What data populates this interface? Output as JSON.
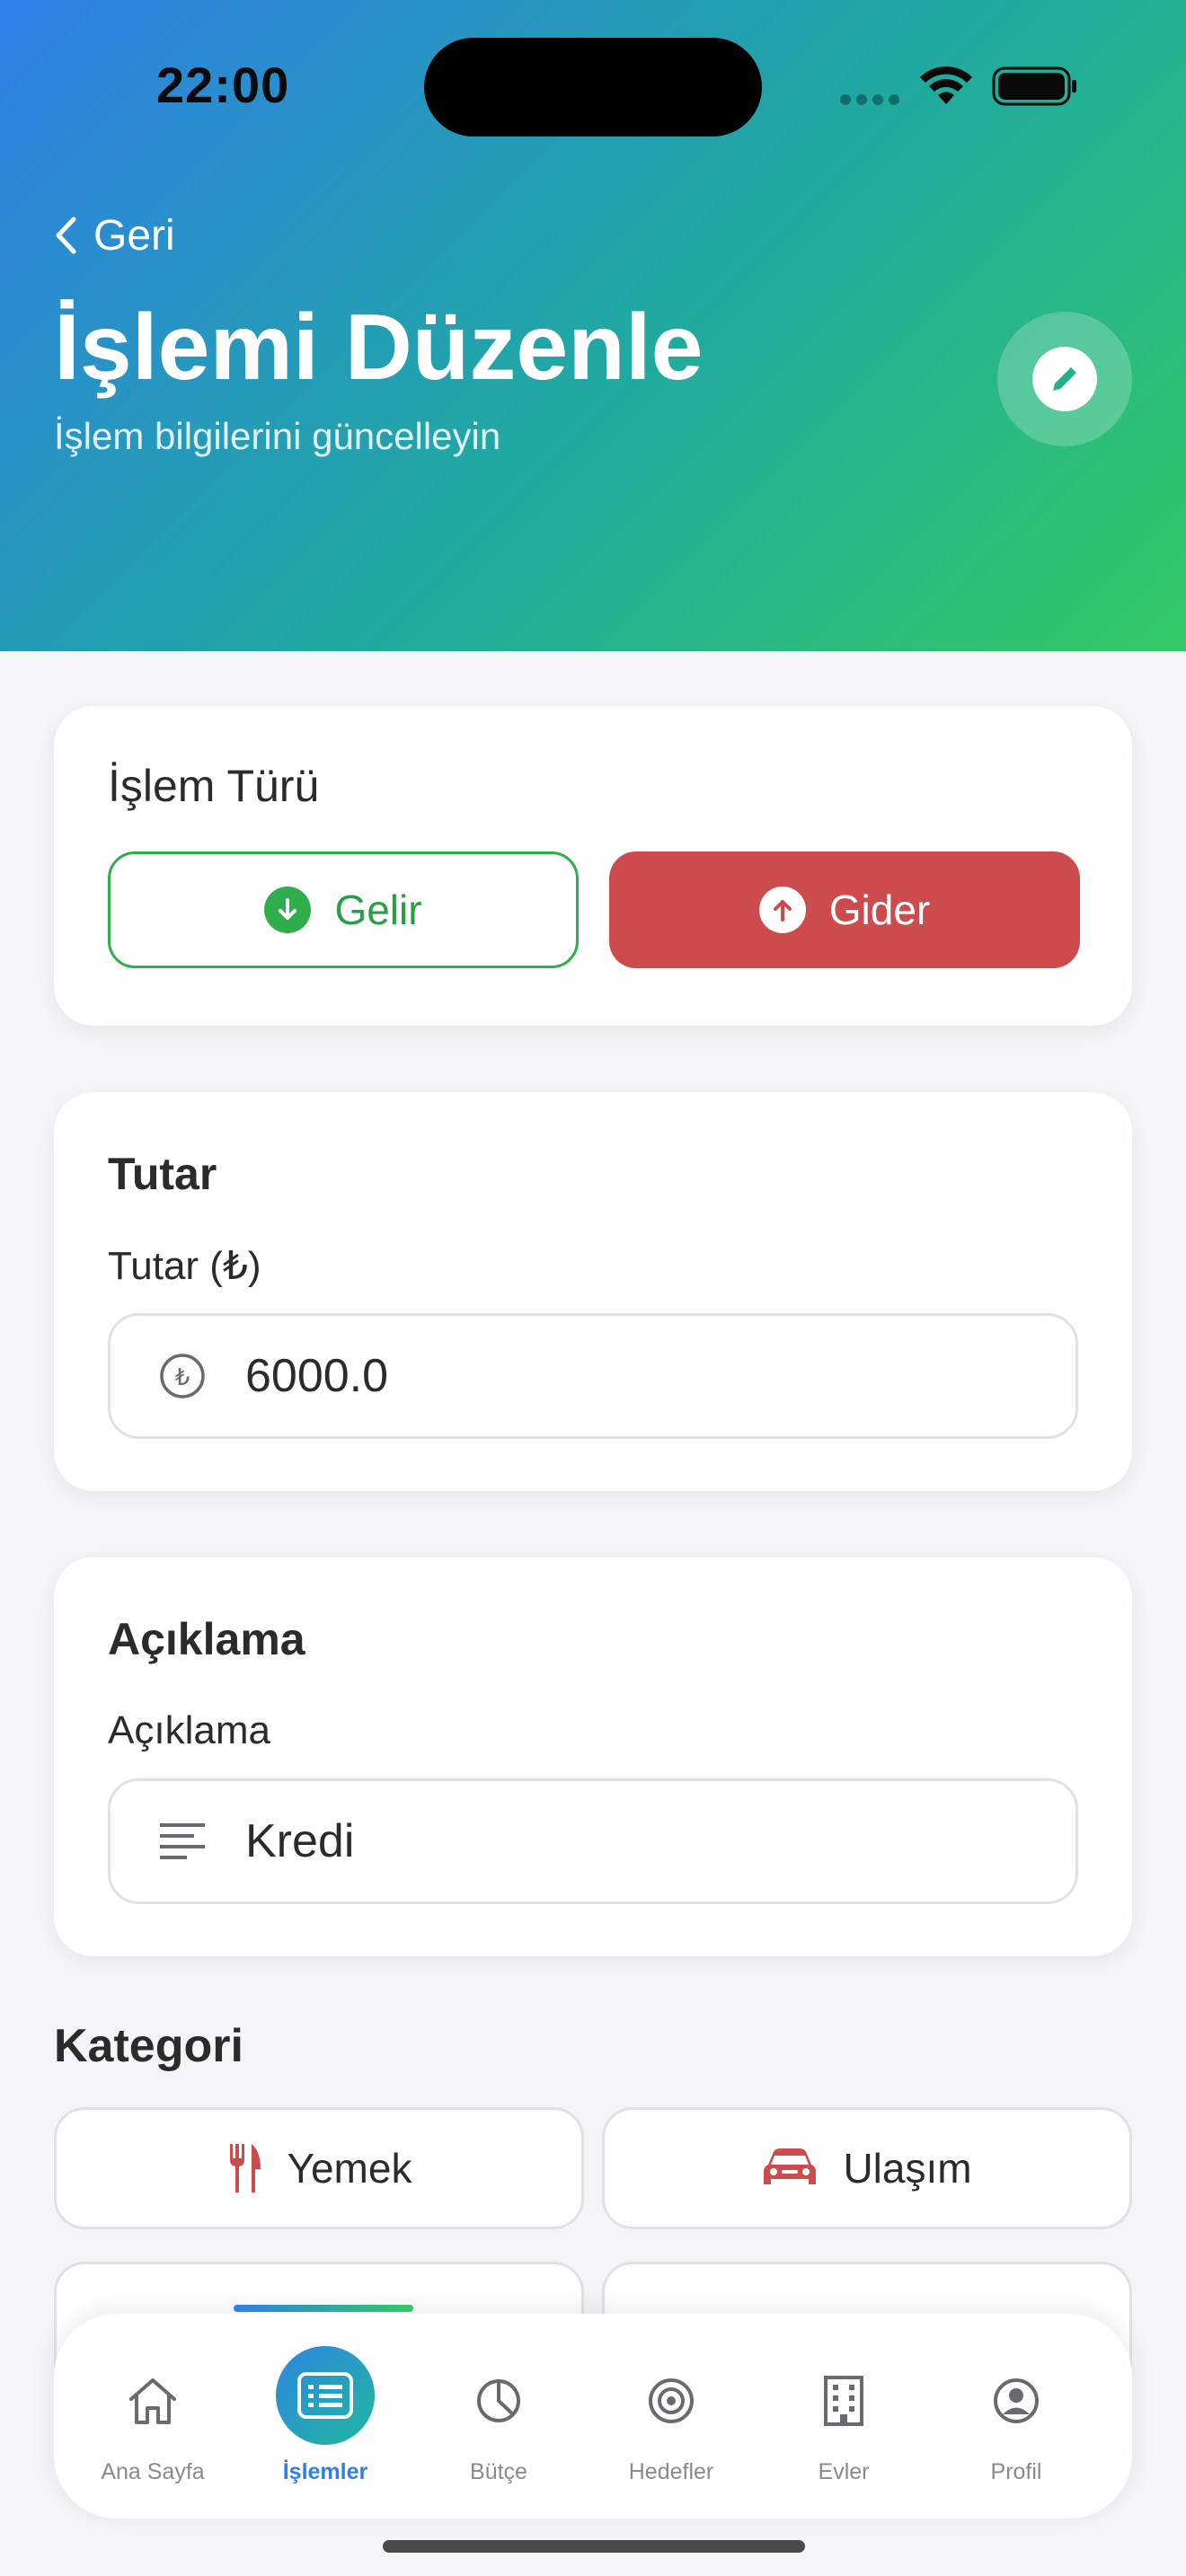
{
  "status_bar": {
    "time": "22:00"
  },
  "header": {
    "back_label": "Geri",
    "title": "İşlemi Düzenle",
    "subtitle": "İşlem bilgilerini güncelleyin"
  },
  "transaction_type": {
    "title": "İşlem Türü",
    "income_label": "Gelir",
    "expense_label": "Gider",
    "selected": "Gider",
    "colors": {
      "income": "#2fae4b",
      "expense": "#cc4c4e"
    }
  },
  "amount": {
    "title": "Tutar",
    "label": "Tutar (₺)",
    "value": "6000.0"
  },
  "description": {
    "title": "Açıklama",
    "label": "Açıklama",
    "value": "Kredi"
  },
  "category": {
    "title": "Kategori",
    "items": [
      {
        "label": "Yemek",
        "icon": "fork-knife-icon"
      },
      {
        "label": "Ulaşım",
        "icon": "car-icon"
      }
    ]
  },
  "tabbar": {
    "items": [
      {
        "label": "Ana Sayfa",
        "icon": "home-icon"
      },
      {
        "label": "İşlemler",
        "icon": "list-icon",
        "active": true
      },
      {
        "label": "Bütçe",
        "icon": "pie-chart-icon"
      },
      {
        "label": "Hedefler",
        "icon": "target-icon"
      },
      {
        "label": "Evler",
        "icon": "building-icon"
      },
      {
        "label": "Profil",
        "icon": "profile-icon"
      }
    ]
  }
}
